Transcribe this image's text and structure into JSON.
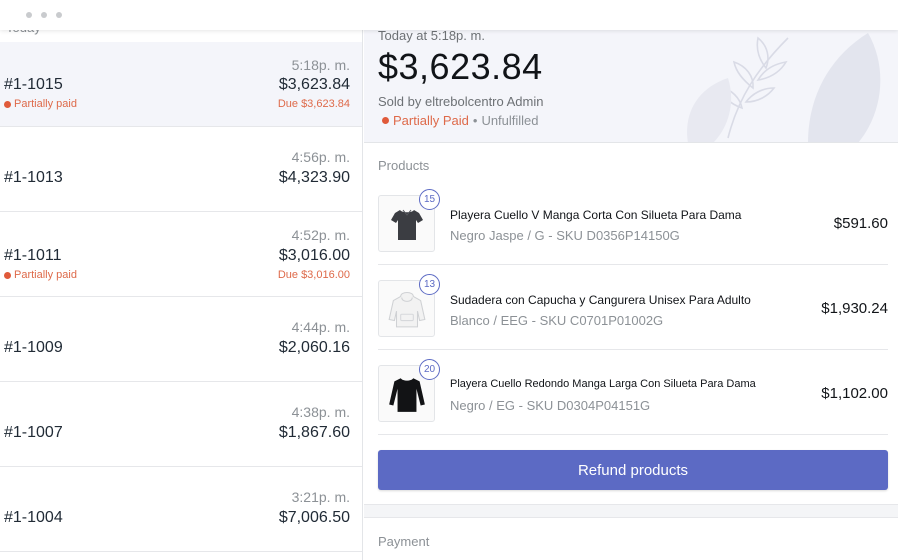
{
  "orders_list": {
    "section_label": "Today",
    "items": [
      {
        "number": "#1-1015",
        "time": "5:18p. m.",
        "amount": "$3,623.84",
        "status": "Partially paid",
        "due": "Due $3,623.84",
        "active": true
      },
      {
        "number": "#1-1013",
        "time": "4:56p. m.",
        "amount": "$4,323.90"
      },
      {
        "number": "#1-1011",
        "time": "4:52p. m.",
        "amount": "$3,016.00",
        "status": "Partially paid",
        "due": "Due $3,016.00"
      },
      {
        "number": "#1-1009",
        "time": "4:44p. m.",
        "amount": "$2,060.16"
      },
      {
        "number": "#1-1007",
        "time": "4:38p. m.",
        "amount": "$1,867.60"
      },
      {
        "number": "#1-1004",
        "time": "3:21p. m.",
        "amount": "$7,006.50"
      }
    ]
  },
  "order_detail": {
    "date": "Today at 5:18p. m.",
    "total": "$3,623.84",
    "sold_by": "Sold by eltrebolcentro Admin",
    "payment_status": "Partially Paid",
    "separator": "•",
    "fulfillment_status": "Unfulfilled",
    "products_title": "Products",
    "products": [
      {
        "quantity": "15",
        "name": "Playera Cuello V Manga Corta Con Silueta Para Dama",
        "variant": "Negro Jaspe / G - SKU D0356P14150G",
        "price": "$591.60",
        "icon": "tshirt-icon"
      },
      {
        "quantity": "13",
        "name": "Sudadera con Capucha y Cangurera Unisex Para Adulto",
        "variant": "Blanco / EEG - SKU C0701P01002G",
        "price": "$1,930.24",
        "icon": "hoodie-icon"
      },
      {
        "quantity": "20",
        "name": "Playera Cuello Redondo Manga Larga Con Silueta Para Dama",
        "variant": "Negro / EG - SKU D0304P04151G",
        "price": "$1,102.00",
        "icon": "longsleeve-icon"
      }
    ],
    "refund_label": "Refund products",
    "payment_title": "Payment"
  },
  "colors": {
    "accent": "#5c6ac4",
    "warning": "#de6a4a",
    "hero_bg": "#f4f5fa"
  }
}
